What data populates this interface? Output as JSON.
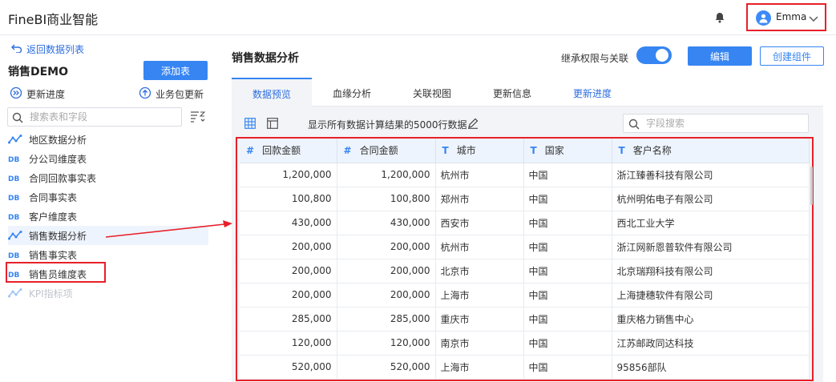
{
  "app": {
    "title": "FineBI商业智能",
    "user": "Emma"
  },
  "sidebar": {
    "back_label": "返回数据列表",
    "package_title": "销售DEMO",
    "add_table_label": "添加表",
    "update_progress_label": "更新进度",
    "package_update_label": "业务包更新",
    "search_placeholder": "搜索表和字段",
    "items": [
      {
        "label": "地区数据分析",
        "type": "analysis"
      },
      {
        "label": "分公司维度表",
        "type": "db"
      },
      {
        "label": "合同回款事实表",
        "type": "db"
      },
      {
        "label": "合同事实表",
        "type": "db"
      },
      {
        "label": "客户维度表",
        "type": "db"
      },
      {
        "label": "销售数据分析",
        "type": "analysis",
        "selected": true
      },
      {
        "label": "销售事实表",
        "type": "db"
      },
      {
        "label": "销售员维度表",
        "type": "db"
      },
      {
        "label": "KPI指标项",
        "type": "analysis",
        "disabled": true
      }
    ]
  },
  "panel": {
    "title": "销售数据分析",
    "inherit_label": "继承权限与关联",
    "edit_label": "编辑",
    "create_component_label": "创建组件",
    "tabs": [
      "数据预览",
      "血缘分析",
      "关联视图",
      "更新信息",
      "更新进度"
    ],
    "toolbar_text": "显示所有数据计算结果的5000行数据",
    "field_search_placeholder": "字段搜索"
  },
  "table": {
    "columns": [
      {
        "type": "#",
        "name": "回款金额"
      },
      {
        "type": "#",
        "name": "合同金额"
      },
      {
        "type": "T",
        "name": "城市"
      },
      {
        "type": "T",
        "name": "国家"
      },
      {
        "type": "T",
        "name": "客户名称"
      }
    ],
    "rows": [
      [
        "1,200,000",
        "1,200,000",
        "杭州市",
        "中国",
        "浙江臻善科技有限公司"
      ],
      [
        "100,800",
        "100,800",
        "郑州市",
        "中国",
        "杭州明佑电子有限公司"
      ],
      [
        "430,000",
        "430,000",
        "西安市",
        "中国",
        "西北工业大学"
      ],
      [
        "200,000",
        "200,000",
        "杭州市",
        "中国",
        "浙江网新恩普软件有限公司"
      ],
      [
        "200,000",
        "200,000",
        "北京市",
        "中国",
        "北京瑞翔科技有限公司"
      ],
      [
        "200,000",
        "200,000",
        "上海市",
        "中国",
        "上海捷穗软件有限公司"
      ],
      [
        "285,000",
        "285,000",
        "重庆市",
        "中国",
        "重庆格力销售中心"
      ],
      [
        "120,000",
        "120,000",
        "南京市",
        "中国",
        "江苏邮政同达科技"
      ],
      [
        "520,000",
        "520,000",
        "上海市",
        "中国",
        "95856部队"
      ]
    ]
  },
  "colors": {
    "accent": "#3685f2",
    "highlight": "#e8202a",
    "link": "#2c6de0"
  }
}
